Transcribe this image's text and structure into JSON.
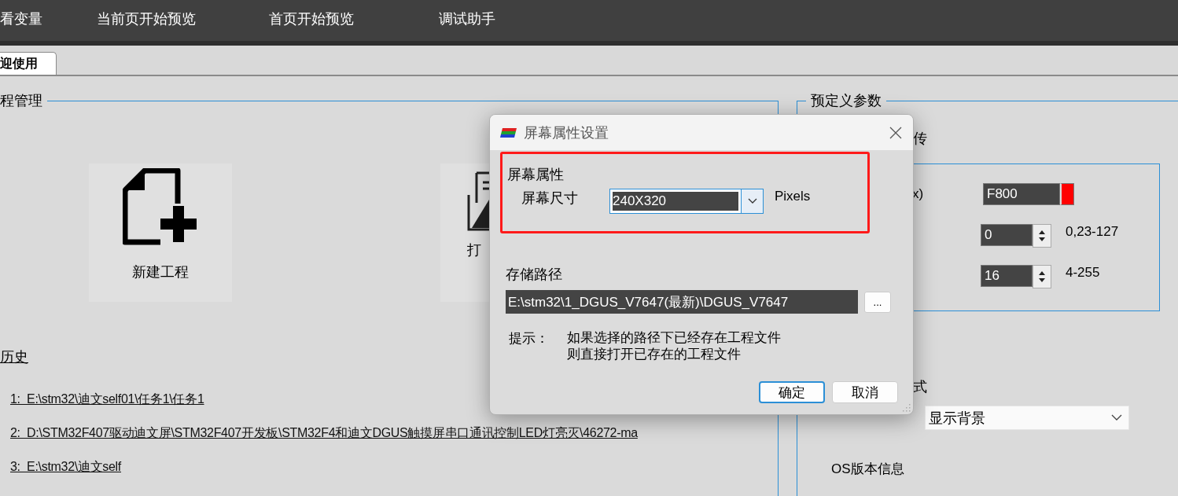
{
  "menu_bar": {
    "items": [
      "看变量",
      "当前页开始预览",
      "首页开始预览",
      "调试助手"
    ]
  },
  "tabs": [
    {
      "label": "迎使用",
      "selected": true
    }
  ],
  "project_group": {
    "title": "程管理",
    "tiles": [
      {
        "kind": "new",
        "label": "新建工程"
      },
      {
        "kind": "open",
        "label": "打"
      }
    ],
    "history_title": "历史",
    "history": [
      "1:  E:\\stm32\\迪文self01\\任务1\\任务1",
      "2:  D:\\STM32F407驱动迪文屏\\STM32F407开发板\\STM32F4和迪文DGUS触摸屏串口通讯控制LED灯亮灭\\46272-ma",
      "3:  E:\\stm32\\迪文self"
    ]
  },
  "params_group": {
    "title": "预定义参数",
    "upload_label": "传",
    "color_label": "x)",
    "color_value": "F800",
    "spinners": [
      {
        "value": "0",
        "range": "0,23-127"
      },
      {
        "value": "16",
        "range": "4-255"
      }
    ],
    "mode_label": "式",
    "mode_value": "显示背景",
    "os_label": "OS版本信息"
  },
  "dialog": {
    "title": "屏幕属性设置",
    "section": "屏幕属性",
    "size_label": "屏幕尺寸",
    "size_value": "240X320",
    "unit": "Pixels",
    "path_label": "存储路径",
    "path_value": "E:\\stm32\\1_DGUS_V7647(最新)\\DGUS_V7647",
    "browse": "...",
    "hint_label": "提示：",
    "hint_lines": [
      "如果选择的路径下已经存在工程文件",
      "则直接打开已存在的工程文件"
    ],
    "buttons": [
      {
        "label": "确定",
        "focused": true
      },
      {
        "label": "取消",
        "focused": false
      }
    ]
  }
}
